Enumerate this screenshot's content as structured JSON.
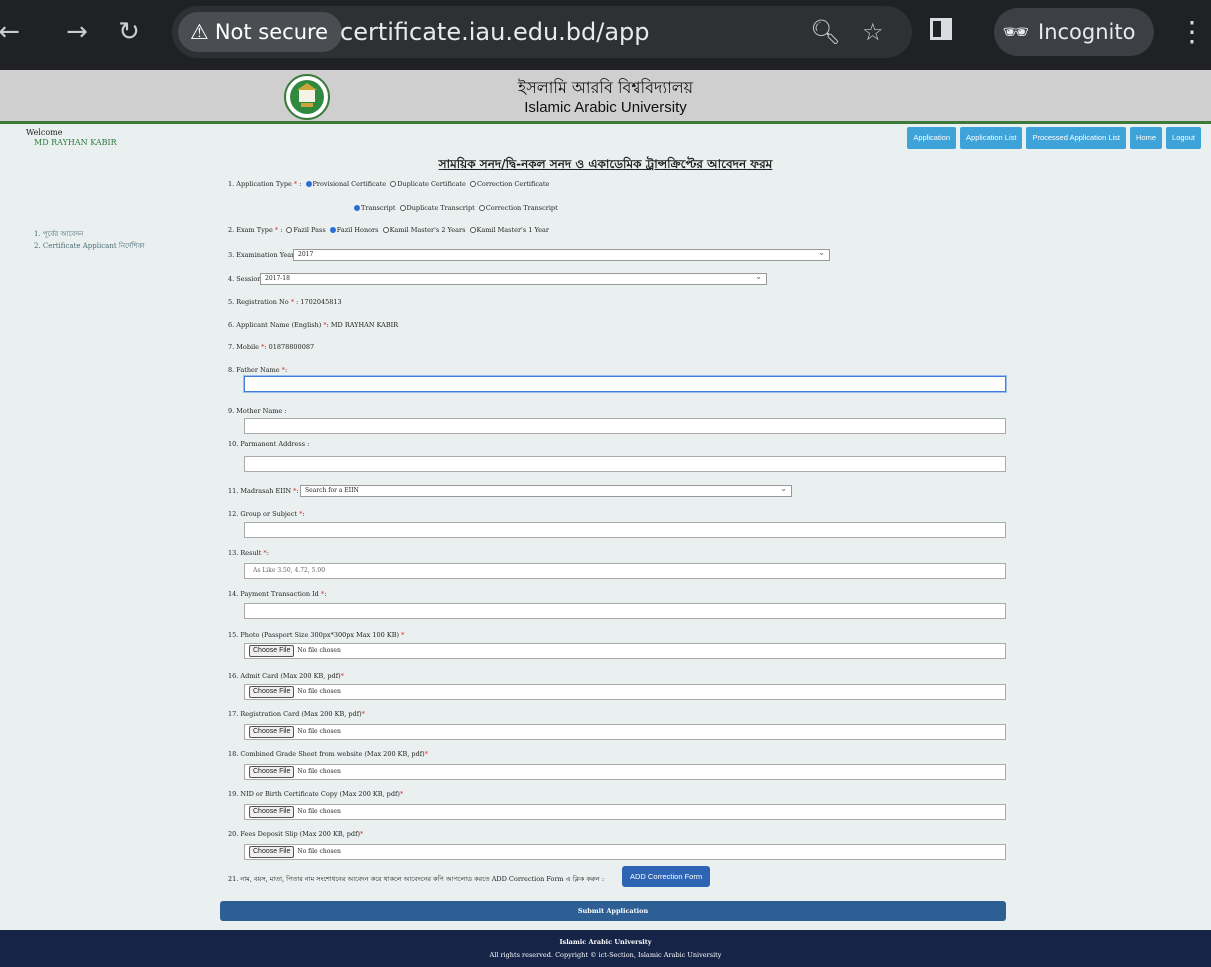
{
  "browser": {
    "security_label": "Not secure",
    "url": "certificate.iau.edu.bd/app",
    "incognito_label": "Incognito"
  },
  "header": {
    "university_bn": "ইসলামি আরবি বিশ্ববিদ্যালয়",
    "university_en": "Islamic Arabic University"
  },
  "user": {
    "welcome_label": "Welcome",
    "name": "MD RAYHAN KABIR"
  },
  "nav": [
    "Application",
    "Application List",
    "Processed Application List",
    "Home",
    "Logout"
  ],
  "sidebar": [
    "1. পূর্বের আবেদন",
    "2. Certificate Applicant নির্দেশিকা"
  ],
  "form": {
    "title": "সাময়িক সনদ/দ্বি-নকল সনদ ও একাডেমিক ট্রান্সক্রিপ্টের আবেদন ফরম",
    "q1_label": "1. Application Type",
    "q1_opt1": "Provisional Certificate",
    "q1_opt2": "Duplicate Certificate",
    "q1_opt3": "Correction Certificate",
    "q1_opt4": "Transcript",
    "q1_opt5": "Duplicate Transcript",
    "q1_opt6": "Correction Transcript",
    "q2_label": "2. Exam Type",
    "q2_opt1": "Fazil Pass",
    "q2_opt2": "Fazil Honors",
    "q2_opt3": "Kamil Master's 2 Years",
    "q2_opt4": "Kamil Master's 1 Year",
    "q3_label": "3. Examination Year",
    "q3_value": "2017",
    "q4_label": "4. Session",
    "q4_value": "2017-18",
    "q5_label": "5. Registration No",
    "q5_value": "1702045813",
    "q6_label": "6. Applicant Name (English)",
    "q6_value": "MD RAYHAN KABIR",
    "q7_label": "7. Mobile",
    "q7_value": "01878800087",
    "q8_label": "8. Father Name",
    "q9_label": "9. Mother Name :",
    "q10_label": "10. Parmanent Address :",
    "q11_label": "11. Madrasah EIIN",
    "q11_value": "Search for a EIIN",
    "q12_label": "12. Group or Subject",
    "q13_label": "13. Result",
    "q13_placeholder": "As Like 3.50, 4.72, 5.00",
    "q14_label": "14. Payment Transaction Id",
    "q15_label": "15. Photo (Passport Size 300px*300px Max 100 KB)",
    "q16_label": "16. Admit Card (Max 200 KB, pdf)",
    "q17_label": "17. Registration Card (Max 200 KB, pdf)",
    "q18_label": "18. Combined Grade Sheet from website (Max 200 KB, pdf)",
    "q19_label": "19. NID or Birth Certificate Copy (Max 200 KB, pdf)",
    "q20_label": "20. Fees Deposit Slip (Max 200 KB, pdf)",
    "q21_label": "21. নাম, বয়স, মাতা, পিতার নাম সংশোধনের আবেদন করে থাকলে আবেদনের কপি আপলোড করতে ADD Correction Form এ ক্লিক করুন :",
    "choose_file": "Choose File",
    "no_file": "No file chosen",
    "add_correction": "ADD Correction Form",
    "submit": "Submit Application"
  },
  "footer": {
    "line1": "Islamic Arabic University",
    "line2": "All rights reserved. Copyright © ict-Section, Islamic Arabic University"
  },
  "colors": {
    "nav_button": "#3ea3d8",
    "submit_bar": "#2d5f95",
    "footer_bg": "#162447",
    "header_bg": "#cfcfcf",
    "page_bg": "#eaf0ef"
  }
}
